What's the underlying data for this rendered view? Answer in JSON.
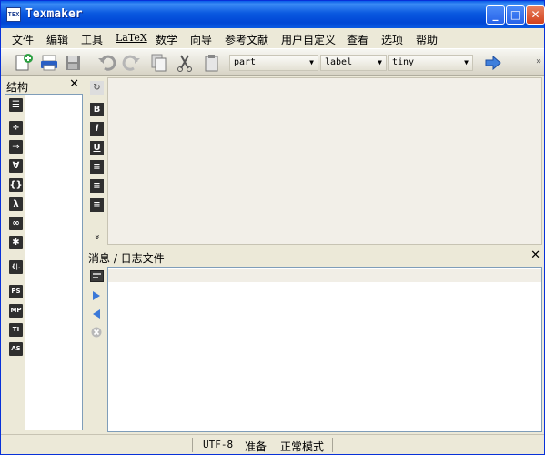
{
  "window": {
    "title": "Texmaker",
    "icon_text": "TEX",
    "controls": {
      "minimize": "_",
      "maximize": "□",
      "close": "✕"
    }
  },
  "menu": [
    {
      "label": "文件",
      "underline": true
    },
    {
      "label": "编辑",
      "underline": true
    },
    {
      "label": "工具",
      "underline": true
    },
    {
      "label": "LaTeX",
      "underline": true
    },
    {
      "label": "数学",
      "underline": true
    },
    {
      "label": "向导",
      "underline": true
    },
    {
      "label": "参考文献",
      "underline": true
    },
    {
      "label": "用户自定义",
      "underline": true
    },
    {
      "label": "查看",
      "underline": true
    },
    {
      "label": "选项",
      "underline": true
    },
    {
      "label": "帮助",
      "underline": true
    }
  ],
  "toolbar": {
    "combos": [
      {
        "value": "part"
      },
      {
        "value": "label"
      },
      {
        "value": "tiny"
      }
    ],
    "more": "»"
  },
  "structure_panel": {
    "title": "结构",
    "close": "✕",
    "icons": [
      {
        "name": "list-icon",
        "glyph": "☰"
      },
      {
        "name": "divide-icon",
        "glyph": "÷"
      },
      {
        "name": "arrow-icon",
        "glyph": "⇒"
      },
      {
        "name": "forall-icon",
        "glyph": "∀"
      },
      {
        "name": "braces-icon",
        "glyph": "{}"
      },
      {
        "name": "lambda-icon",
        "glyph": "λ"
      },
      {
        "name": "infinity-icon",
        "glyph": "∞"
      },
      {
        "name": "star-icon",
        "glyph": "✱"
      },
      {
        "name": "left-delim-icon",
        "glyph": "{|."
      },
      {
        "name": "pstricks-icon",
        "glyph": "PS"
      },
      {
        "name": "metapost-icon",
        "glyph": "MP"
      },
      {
        "name": "tikz-icon",
        "glyph": "TI"
      },
      {
        "name": "asymptote-icon",
        "glyph": "AS"
      }
    ]
  },
  "editor_strip": {
    "icons": [
      {
        "name": "refresh-icon",
        "glyph": "↻"
      },
      {
        "name": "bold-icon",
        "glyph": "B"
      },
      {
        "name": "italic-icon",
        "glyph": "i"
      },
      {
        "name": "underline-icon",
        "glyph": "U"
      },
      {
        "name": "align-left-icon",
        "glyph": "≡"
      },
      {
        "name": "align-center-icon",
        "glyph": "≡"
      },
      {
        "name": "align-right-icon",
        "glyph": "≡"
      },
      {
        "name": "expand-icon",
        "glyph": "»"
      }
    ]
  },
  "messages_panel": {
    "title": "消息 / 日志文件",
    "close": "✕"
  },
  "statusbar": {
    "encoding": "UTF-8",
    "state": "准备",
    "mode": "正常模式"
  },
  "colors": {
    "titlebar": "#0046d5",
    "face": "#ece9d8",
    "editor_bg": "#f2efe8"
  }
}
